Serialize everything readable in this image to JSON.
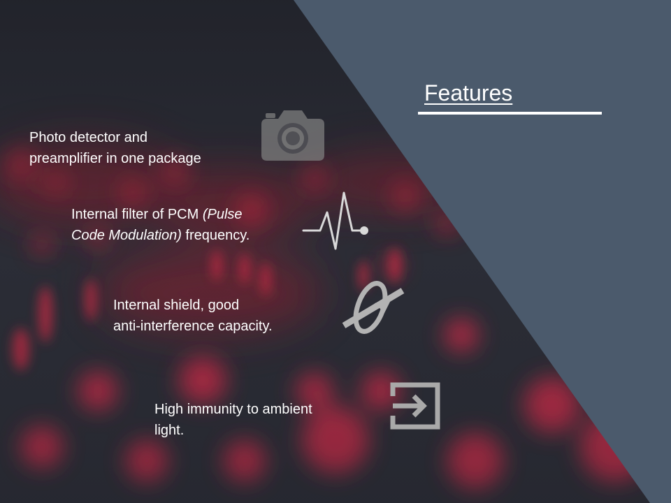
{
  "slide": {
    "title": "Features",
    "features": [
      {
        "lines": [
          "Photo detector and",
          "preamplifier in one package"
        ],
        "icon": "camera-icon"
      },
      {
        "line1_prefix": "Internal filter of PCM ",
        "line1_italic": "(Pulse",
        "line2_italic": "Code Modulation)",
        "line2_suffix": " frequency.",
        "icon": "pulse-icon"
      },
      {
        "lines": [
          "Internal shield, good",
          "anti-interference capacity."
        ],
        "icon": "shield-orbit-icon"
      },
      {
        "lines": [
          "High immunity to ambient",
          "light."
        ],
        "icon": "exit-arrow-icon"
      }
    ]
  },
  "colors": {
    "panel": "#4b5a6c",
    "background": "#2a2c35",
    "accent_red": "#c0283e",
    "text": "#ffffff",
    "icon_gray": "#8a8a8a"
  }
}
